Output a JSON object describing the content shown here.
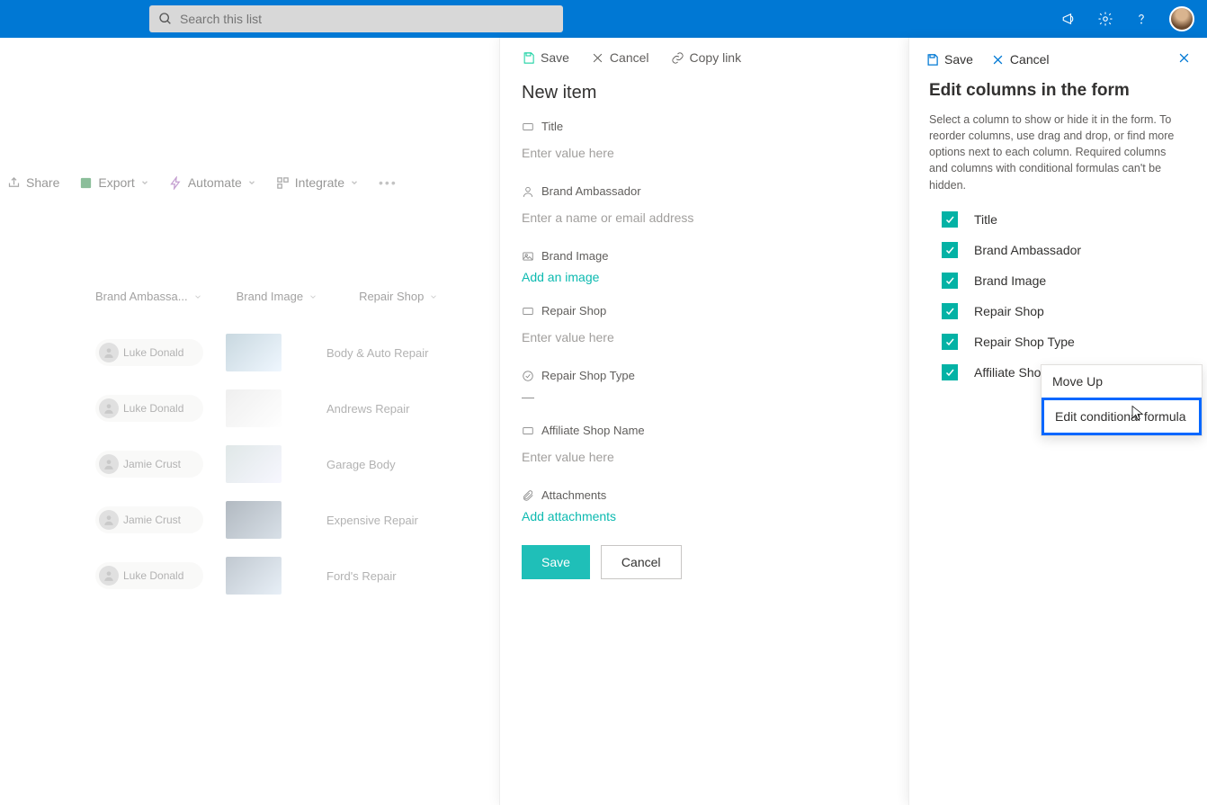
{
  "header": {
    "search_placeholder": "Search this list"
  },
  "commandbar": {
    "share": "Share",
    "export": "Export",
    "automate": "Automate",
    "integrate": "Integrate"
  },
  "listColumns": {
    "brandAmbassador": "Brand Ambassa...",
    "brandImage": "Brand Image",
    "repairShop": "Repair Shop"
  },
  "rows": [
    {
      "person": "Luke Donald",
      "repair": "Body & Auto Repair"
    },
    {
      "person": "Luke Donald",
      "repair": "Andrews Repair"
    },
    {
      "person": "Jamie Crust",
      "repair": "Garage Body"
    },
    {
      "person": "Jamie Crust",
      "repair": "Expensive Repair"
    },
    {
      "person": "Luke Donald",
      "repair": "Ford's Repair"
    }
  ],
  "midPanel": {
    "topSave": "Save",
    "topCancel": "Cancel",
    "topCopyLink": "Copy link",
    "heading": "New item",
    "fields": {
      "title": {
        "label": "Title",
        "placeholder": "Enter value here"
      },
      "brandAmbassador": {
        "label": "Brand Ambassador",
        "placeholder": "Enter a name or email address"
      },
      "brandImage": {
        "label": "Brand Image",
        "action": "Add an image"
      },
      "repairShop": {
        "label": "Repair Shop",
        "placeholder": "Enter value here"
      },
      "repairShopType": {
        "label": "Repair Shop Type",
        "value": "—"
      },
      "affiliate": {
        "label": "Affiliate Shop Name",
        "placeholder": "Enter value here"
      },
      "attachments": {
        "label": "Attachments",
        "action": "Add attachments"
      }
    },
    "btnSave": "Save",
    "btnCancel": "Cancel"
  },
  "rightPanel": {
    "topSave": "Save",
    "topCancel": "Cancel",
    "heading": "Edit columns in the form",
    "desc": "Select a column to show or hide it in the form. To reorder columns, use drag and drop, or find more options next to each column. Required columns and columns with conditional formulas can't be hidden.",
    "columns": [
      "Title",
      "Brand Ambassador",
      "Brand Image",
      "Repair Shop",
      "Repair Shop Type",
      "Affiliate Shop Name"
    ]
  },
  "contextMenu": {
    "moveUp": "Move Up",
    "editFormula": "Edit conditional formula"
  }
}
